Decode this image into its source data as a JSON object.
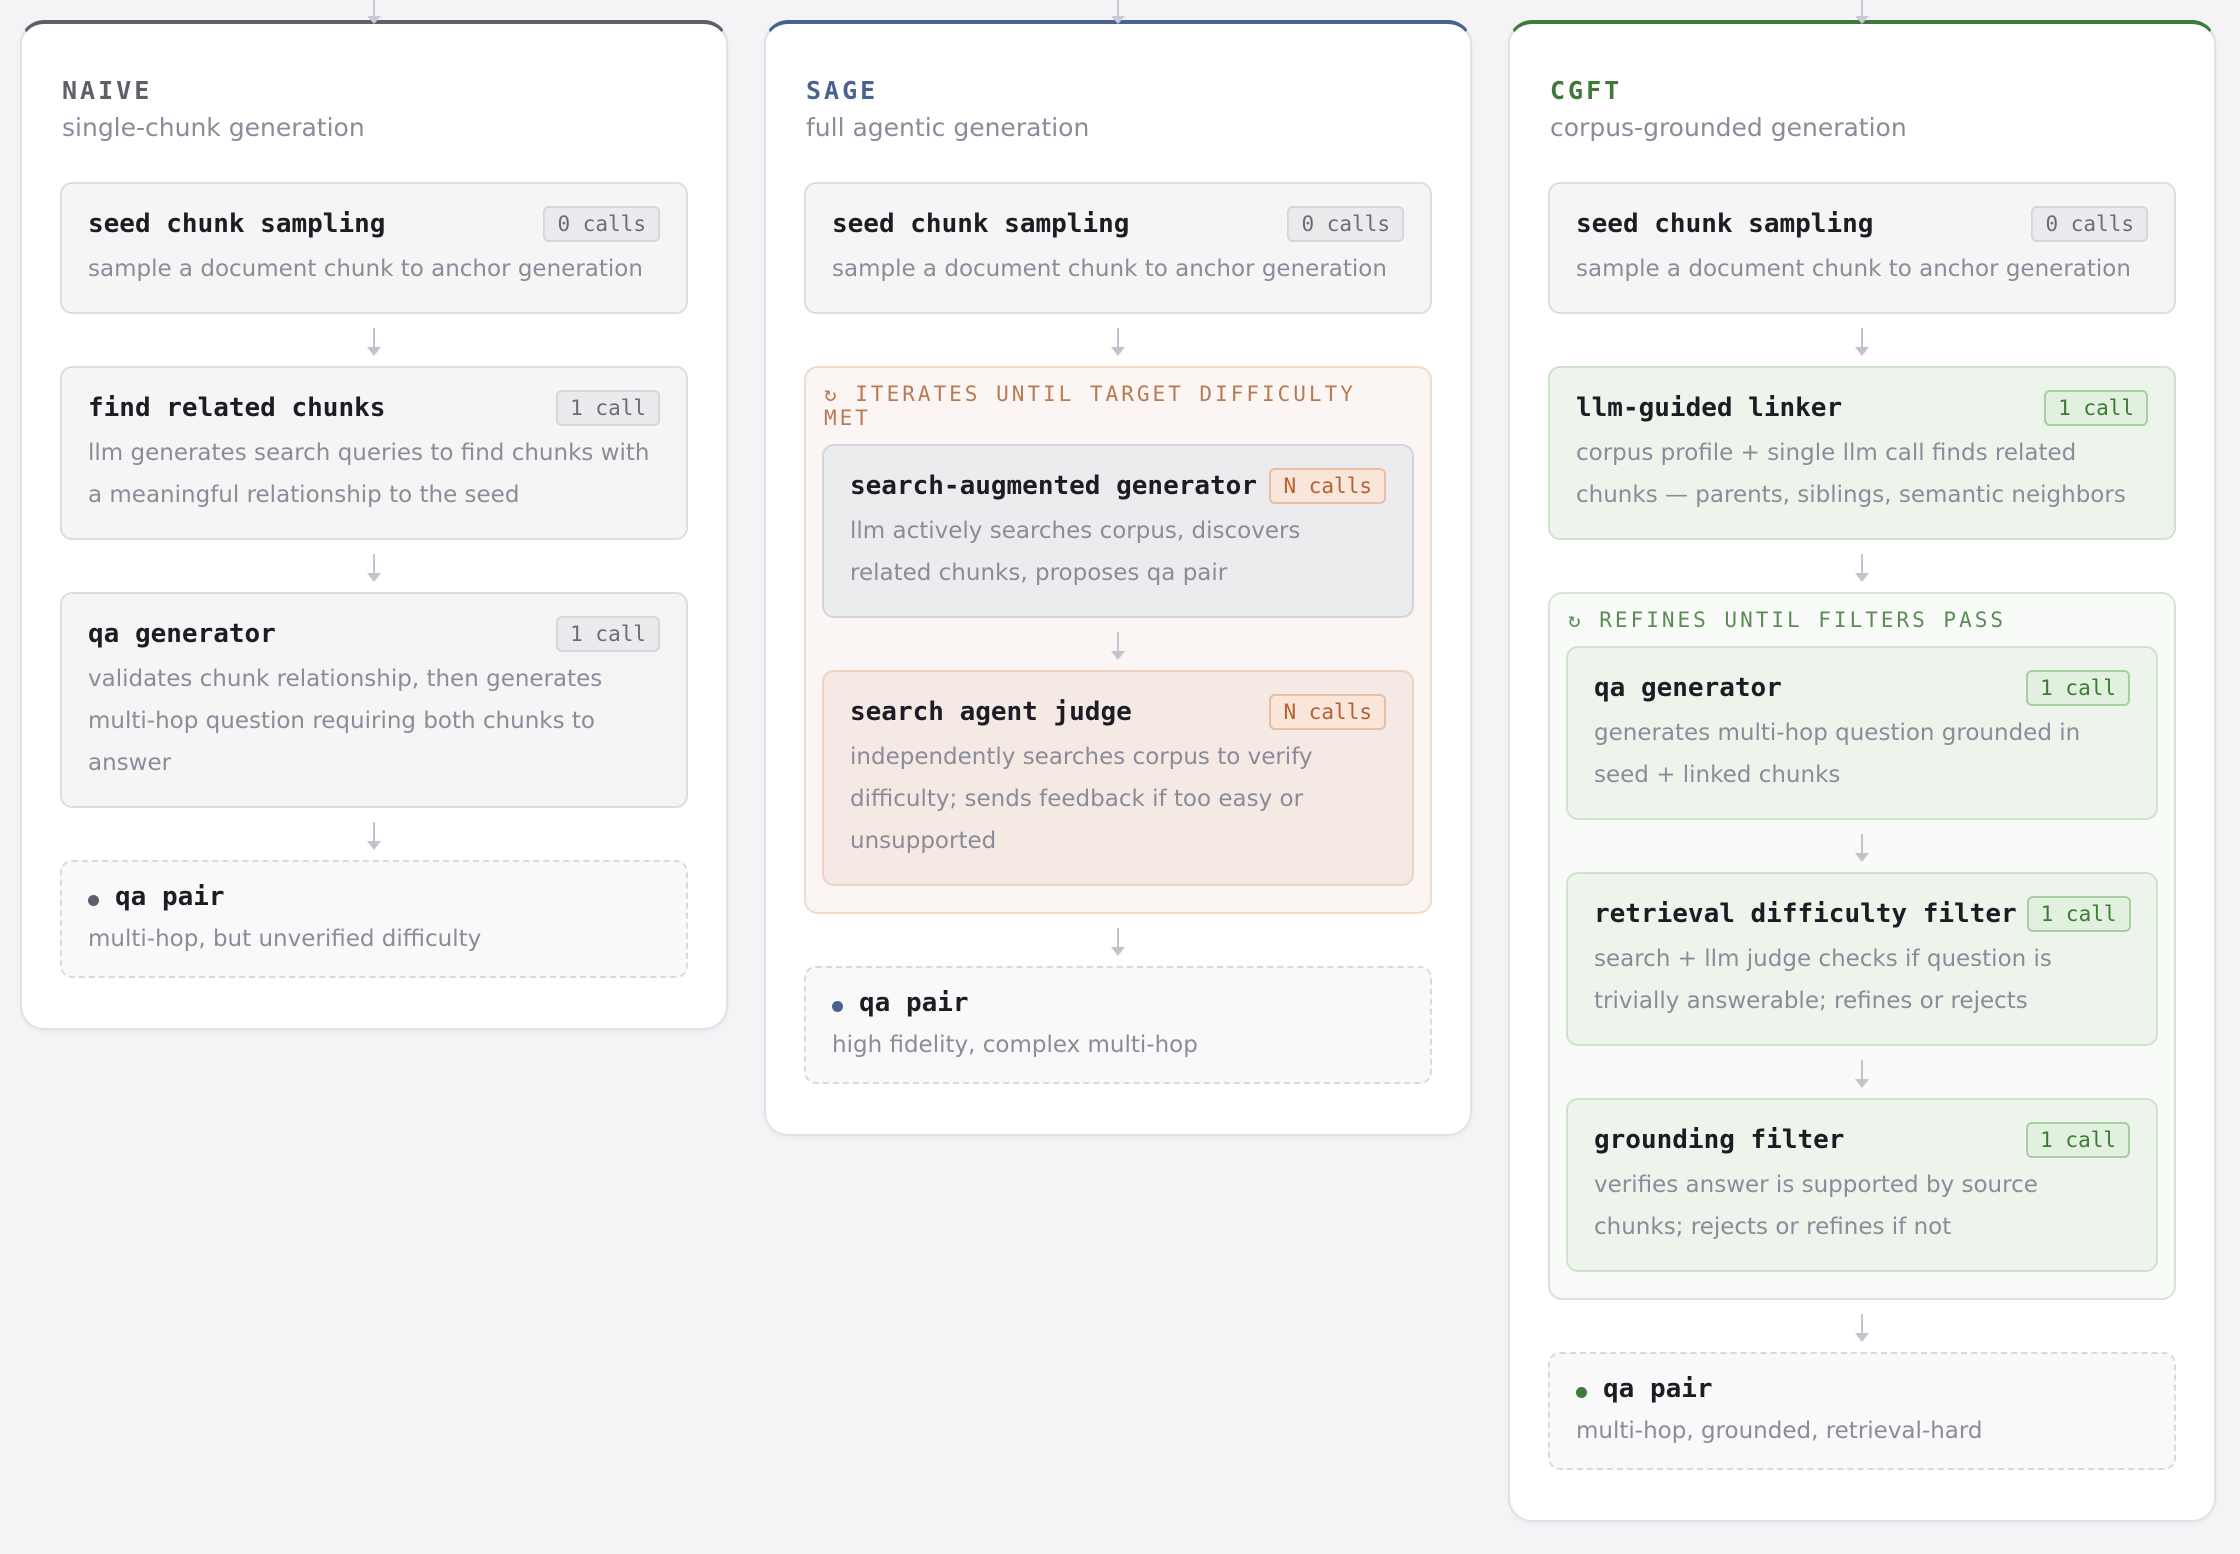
{
  "columns": [
    {
      "title": "NAIVE",
      "subtitle": "single-chunk generation",
      "accent": "#5e5f6a",
      "steps": [
        {
          "title": "seed chunk sampling",
          "badge": "0 calls",
          "desc": "sample a document chunk to anchor generation"
        },
        {
          "title": "find related chunks",
          "badge": "1 call",
          "desc": "llm generates search queries to find chunks with a meaningful relationship to the seed"
        },
        {
          "title": "qa generator",
          "badge": "1 call",
          "desc": "validates chunk relationship, then generates multi-hop question requiring both chunks to answer"
        }
      ],
      "output": {
        "title": "qa pair",
        "desc": "multi-hop, but unverified difficulty"
      }
    },
    {
      "title": "SAGE",
      "subtitle": "full agentic generation",
      "accent": "#4b6290",
      "steps": [
        {
          "title": "seed chunk sampling",
          "badge": "0 calls",
          "desc": "sample a document chunk to anchor generation"
        }
      ],
      "loop": {
        "label": "↻ ITERATES UNTIL TARGET DIFFICULTY MET",
        "steps": [
          {
            "title": "search-augmented generator",
            "badge": "N calls",
            "desc": "llm actively searches corpus, discovers related chunks, proposes qa pair"
          },
          {
            "title": "search agent judge",
            "badge": "N calls",
            "desc": "independently searches corpus to verify difficulty; sends feedback if too easy or unsupported"
          }
        ]
      },
      "output": {
        "title": "qa pair",
        "desc": "high fidelity, complex multi-hop"
      }
    },
    {
      "title": "CGFT",
      "subtitle": "corpus-grounded generation",
      "accent": "#3f7a3b",
      "steps": [
        {
          "title": "seed chunk sampling",
          "badge": "0 calls",
          "desc": "sample a document chunk to anchor generation"
        },
        {
          "title": "llm-guided linker",
          "badge": "1 call",
          "desc": "corpus profile + single llm call finds related chunks — parents, siblings, semantic neighbors"
        }
      ],
      "loop": {
        "label": "↻ REFINES UNTIL FILTERS PASS",
        "steps": [
          {
            "title": "qa generator",
            "badge": "1 call",
            "desc": "generates multi-hop question grounded in seed + linked chunks"
          },
          {
            "title": "retrieval difficulty filter",
            "badge": "1 call",
            "desc": "search + llm judge checks if question is trivially answerable; refines or rejects"
          },
          {
            "title": "grounding filter",
            "badge": "1 call",
            "desc": "verifies answer is supported by source chunks; rejects or refines if not"
          }
        ]
      },
      "output": {
        "title": "qa pair",
        "desc": "multi-hop, grounded, retrieval-hard"
      }
    }
  ]
}
